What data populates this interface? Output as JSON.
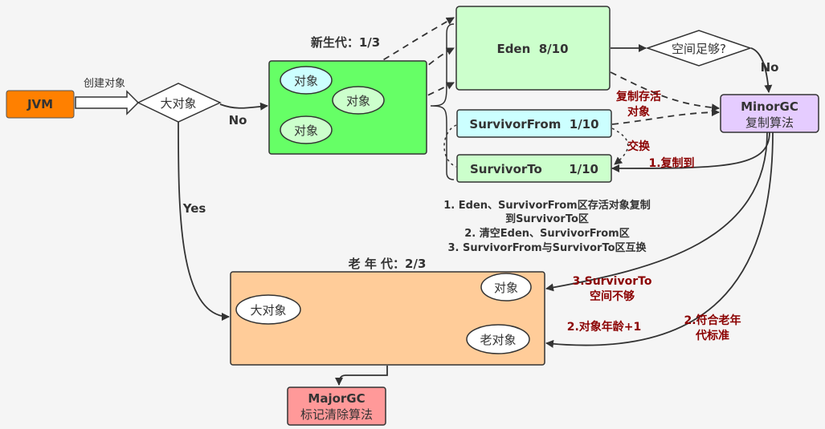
{
  "nodes": {
    "jvm": "JVM",
    "create_label": "创建对象",
    "big_object_decision": "大对象",
    "no_label_1": "No",
    "yes_label": "Yes",
    "young_title": "新生代：1/3",
    "young_obj_1": "对象",
    "young_obj_2": "对象",
    "young_obj_3": "对象",
    "eden": "Eden  8/10",
    "space_enough": "空间足够?",
    "no_label_2": "No",
    "minor_gc_1": "MinorGC",
    "minor_gc_2": "复制算法",
    "copy_live_1": "复制存活",
    "copy_live_2": "对象",
    "survivor_from": "SurvivorFrom  1/10",
    "survivor_to_name": "SurvivorTo",
    "survivor_to_size": "1/10",
    "swap": "交换",
    "copy_to": "1.复制到",
    "old_title": "老 年 代：2/3",
    "old_big_object": "大对象",
    "old_object": "对象",
    "old_old_object": "老对象",
    "survivor_insufficient_1": "3.SurvivorTo",
    "survivor_insufficient_2": "空间不够",
    "age_plus": "2.对象年龄+1",
    "old_standard_1": "2.符合老年",
    "old_standard_2": "代标准",
    "major_gc_1": "MajorGC",
    "major_gc_2": "标记清除算法"
  },
  "notes": [
    "1. Eden、SurvivorFrom区存活对象复制",
    "到SurvivorTo区",
    "2. 清空Eden、SurvivorFrom区",
    "3. SurvivorFrom与SurvivorTo区互换"
  ],
  "colors": {
    "jvm": "#ff8000",
    "young": "#66ff66",
    "eden": "#ccffcc",
    "survivor_from": "#ccffff",
    "survivor_to": "#ccffcc",
    "minor_gc": "#e5ccff",
    "old": "#ffcc99",
    "major_gc": "#ff9999",
    "annotation": "#8b0000"
  }
}
